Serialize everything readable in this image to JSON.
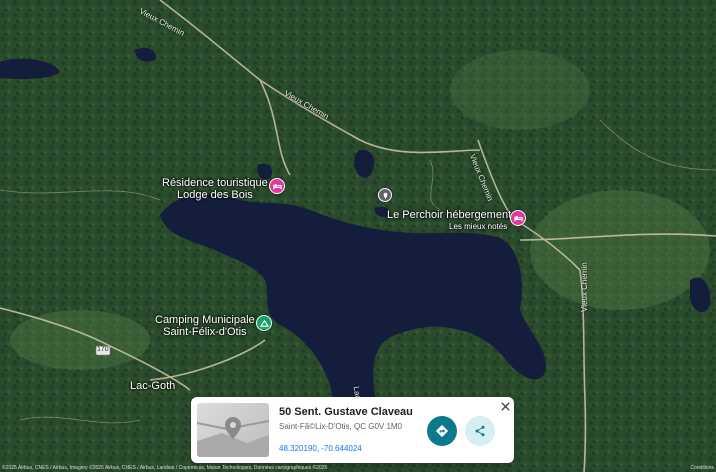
{
  "map": {
    "colors": {
      "forest": "#2b4a2c",
      "water": "#141c3a",
      "road": "#c9c2a8",
      "lodging_pin": "#e0389b",
      "camp_pin": "#1aa06a"
    },
    "roads": [
      "Vieux Chemin",
      "Vieux Chemin",
      "Vieux Chemin",
      "Vieux Chemin",
      "Lac",
      "170"
    ],
    "places": [
      {
        "line1": "Résidence touristique",
        "line2": "Lodge des Bois",
        "icon": "hotel-icon"
      },
      {
        "line1": "Le Perchoir hébergement",
        "line2": "Les mieux notés",
        "icon": "hotel-icon"
      },
      {
        "line1": "Camping Municipale",
        "line2": "Saint-Félix-d'Otis",
        "icon": "camping-icon"
      },
      {
        "line1": "Lac-Goth",
        "line2": ""
      }
    ]
  },
  "card": {
    "title": "50 Sent. Gustave Claveau",
    "address": "Saint-Fã©Lix-D'Otis, QC G0V 1M0",
    "coords": "48.320190, -70.644024",
    "icons": {
      "directions": "directions-icon",
      "share": "share-icon",
      "close": "close-icon"
    }
  },
  "attribution": {
    "left": "©2025 Airbus, CNES / Airbus, Imagery ©2025 Airbus, CNES / Airbus, Landsat / Copernicus, Maxar Technologies, Données cartographiques ©2025",
    "right": "Conditions"
  }
}
